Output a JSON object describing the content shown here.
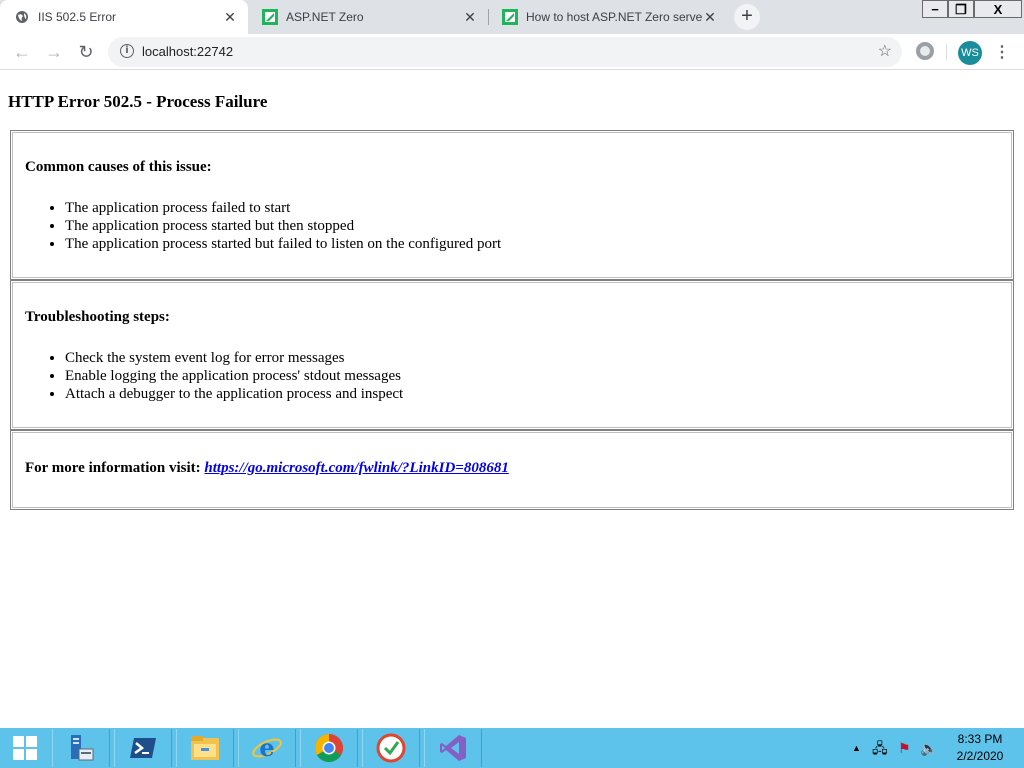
{
  "browser": {
    "tabs": [
      {
        "title": "IIS 502.5 Error",
        "active": true
      },
      {
        "title": "ASP.NET Zero",
        "active": false
      },
      {
        "title": "How to host ASP.NET Zero server",
        "active": false
      }
    ],
    "new_tab_label": "+",
    "window_controls": {
      "minimize": "−",
      "restore": "❐",
      "close": "X"
    },
    "address": "localhost:22742",
    "nav": {
      "back": "←",
      "forward": "→",
      "reload": "↻"
    },
    "info_glyph": "i",
    "star_glyph": "☆",
    "menu_glyph": "⋮",
    "profile_initials": "WS",
    "close_glyph": "✕"
  },
  "error_page": {
    "heading": "HTTP Error 502.5 - Process Failure",
    "causes": {
      "title": "Common causes of this issue:",
      "items": [
        "The application process failed to start",
        "The application process started but then stopped",
        "The application process started but failed to listen on the configured port"
      ]
    },
    "troubleshooting": {
      "title": "Troubleshooting steps:",
      "items": [
        "Check the system event log for error messages",
        "Enable logging the application process' stdout messages",
        "Attach a debugger to the application process and inspect"
      ]
    },
    "more_info": {
      "label": "For more information visit:",
      "link": "https://go.microsoft.com/fwlink/?LinkID=808681"
    }
  },
  "taskbar": {
    "apps": [
      "server-manager-icon",
      "powershell-icon",
      "file-explorer-icon",
      "internet-explorer-icon",
      "chrome-icon",
      "task-app-icon",
      "visual-studio-icon"
    ],
    "tray_glyphs": {
      "overflow": "▲",
      "network": "🖧",
      "flag": "⚑",
      "speaker": "🔈"
    },
    "time": "8:33 PM",
    "date": "2/2/2020"
  },
  "colors": {
    "tabstrip": "#dee1e6",
    "taskbar": "#5ec3ea",
    "link": "#0000ee",
    "avatar": "#1a8d9c",
    "aspnetzero_green": "#1fb55a"
  }
}
